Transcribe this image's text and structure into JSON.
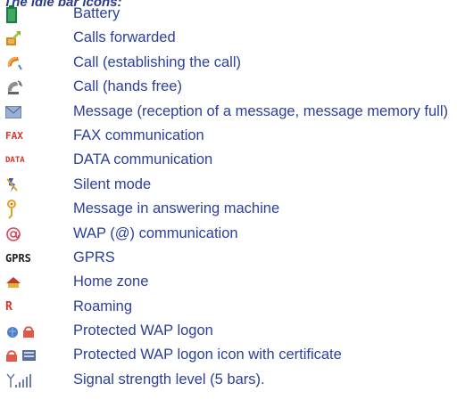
{
  "section_title": "The idle bar icons:",
  "rows": [
    {
      "icon": "battery-icon",
      "label": "Battery"
    },
    {
      "icon": "calls-forwarded-icon",
      "label": "Calls forwarded"
    },
    {
      "icon": "call-establishing-icon",
      "label": "Call (establishing the call)"
    },
    {
      "icon": "call-hands-free-icon",
      "label": "Call (hands free)"
    },
    {
      "icon": "message-envelope-icon",
      "label": "Message (reception of a message, message memory full)"
    },
    {
      "icon": "fax-icon",
      "icon_text": "FAX",
      "label": "FAX communication"
    },
    {
      "icon": "data-icon",
      "icon_text": "DATA",
      "label": "DATA communication"
    },
    {
      "icon": "silent-mode-icon",
      "label": "Silent mode"
    },
    {
      "icon": "answering-machine-icon",
      "label": "Message in answering machine"
    },
    {
      "icon": "wap-at-icon",
      "label": "WAP (@) communication"
    },
    {
      "icon": "gprs-icon",
      "icon_text": "GPRS",
      "label": "GPRS"
    },
    {
      "icon": "home-zone-icon",
      "label": "Home zone"
    },
    {
      "icon": "roaming-icon",
      "icon_text": "R",
      "label": "Roaming"
    },
    {
      "icon": "protected-wap-logon-icon",
      "label": "Protected WAP logon"
    },
    {
      "icon": "protected-wap-certificate-icon",
      "label": "Protected WAP logon icon with certificate"
    },
    {
      "icon": "signal-strength-icon",
      "label": "Signal strength level (5 bars)."
    }
  ],
  "colors": {
    "text": "#2b3f9b",
    "heading": "#2a3a8c"
  }
}
